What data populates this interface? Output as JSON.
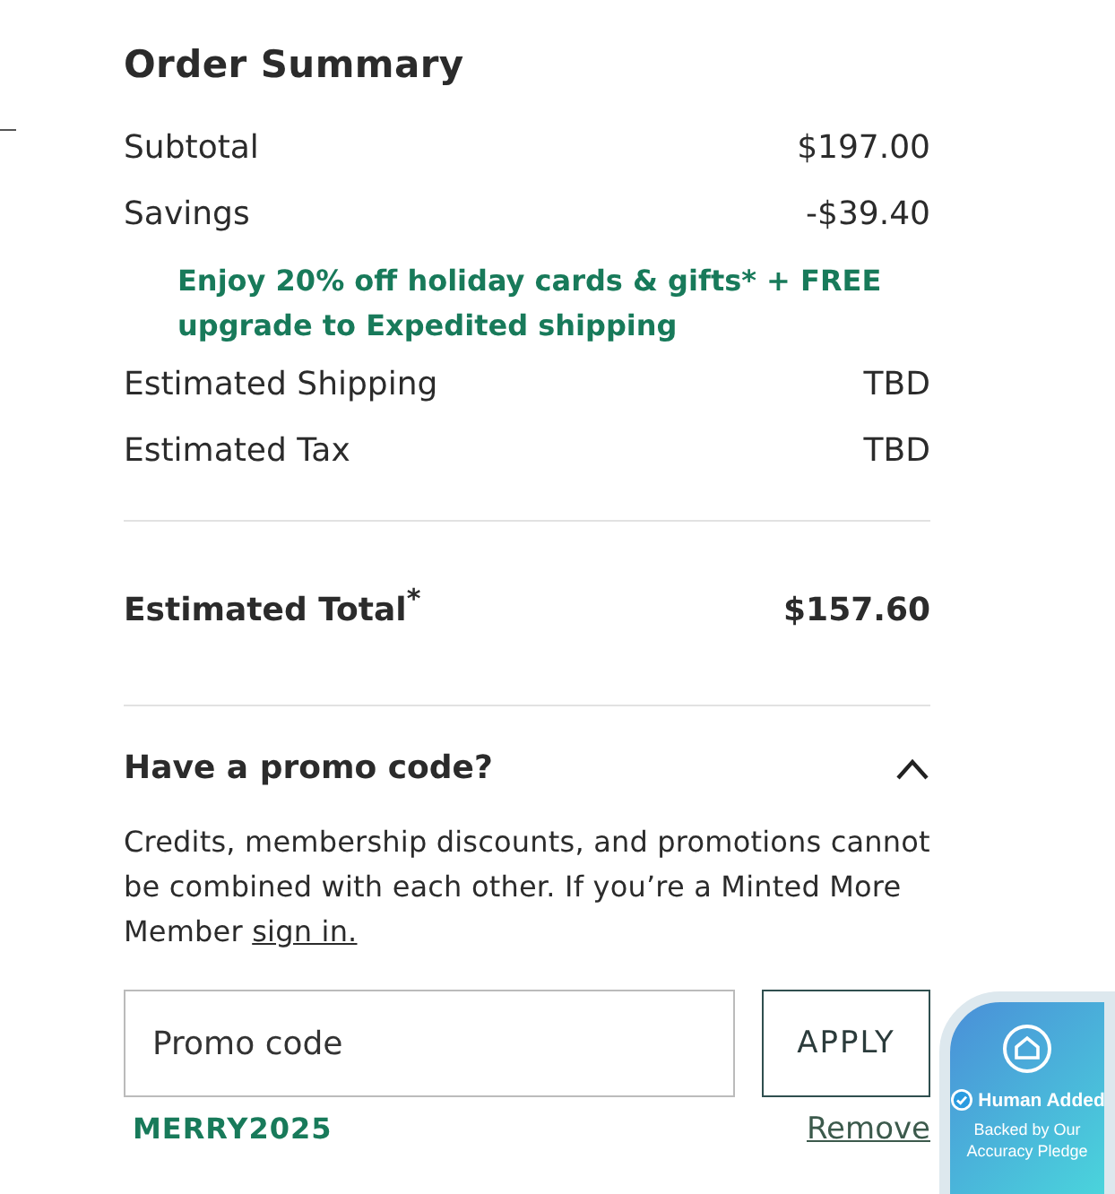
{
  "order_summary": {
    "title": "Order Summary",
    "lines": [
      {
        "label": "Subtotal",
        "value": "$197.00"
      },
      {
        "label": "Savings",
        "value": "-$39.40"
      }
    ],
    "promo_message": "Enjoy 20% off holiday cards & gifts* + FREE upgrade to Expedited shipping",
    "more_lines": [
      {
        "label": "Estimated Shipping",
        "value": "TBD"
      },
      {
        "label": "Estimated Tax",
        "value": "TBD"
      }
    ],
    "total": {
      "label": "Estimated Total$^{*}$",
      "value": "$157.60"
    }
  },
  "promo": {
    "heading": "Have a promo code?",
    "expanded": true,
    "note": "Credits, membership discounts, and promotions cannot be combined with each other. If you’re a Minted More Member ",
    "note_link": "sign in.",
    "field": {
      "placeholder": "Promo code"
    },
    "apply_button": "APPLY",
    "applied_code": "MERRY2025",
    "remove_link": "Remove"
  },
  "badge": {
    "title": "Human Added",
    "subtitle": "Backed by Our Accuracy Pledge"
  }
}
